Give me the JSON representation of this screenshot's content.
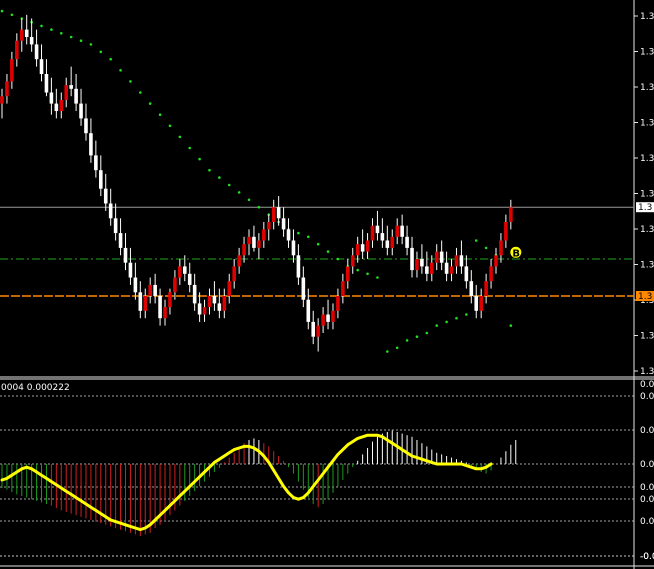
{
  "chart_data": [
    {
      "type": "candlestick",
      "panel": "main",
      "y_tick_labels": [
        "1.3",
        "1.3",
        "1.3",
        "1.3",
        "1.3",
        "1.3",
        "1.3",
        "1.3",
        "1.3",
        "1.3",
        "1.3"
      ],
      "price_marker_label": "1.3",
      "lower_marker_label": "1.3",
      "colors": {
        "background": "#000000",
        "bull": "#e00000",
        "bear": "#ffffff",
        "wick": "#ffffff",
        "sar": "#22dd22",
        "ma_dashed": "#22aa22",
        "hline": "#ff8800",
        "price_line": "#9a9a9a",
        "marker_bg": "#ffff00"
      },
      "ylim": [
        0,
        100
      ],
      "candles": [
        {
          "o": 72,
          "h": 76,
          "l": 68,
          "c": 74
        },
        {
          "o": 74,
          "h": 80,
          "l": 72,
          "c": 78
        },
        {
          "o": 78,
          "h": 86,
          "l": 76,
          "c": 84
        },
        {
          "o": 84,
          "h": 91,
          "l": 82,
          "c": 89
        },
        {
          "o": 89,
          "h": 95,
          "l": 86,
          "c": 92
        },
        {
          "o": 92,
          "h": 96,
          "l": 88,
          "c": 90
        },
        {
          "o": 90,
          "h": 95,
          "l": 86,
          "c": 88
        },
        {
          "o": 88,
          "h": 92,
          "l": 82,
          "c": 84
        },
        {
          "o": 84,
          "h": 88,
          "l": 78,
          "c": 80
        },
        {
          "o": 80,
          "h": 84,
          "l": 74,
          "c": 75
        },
        {
          "o": 75,
          "h": 79,
          "l": 69,
          "c": 72
        },
        {
          "o": 72,
          "h": 76,
          "l": 68,
          "c": 70
        },
        {
          "o": 70,
          "h": 75,
          "l": 68,
          "c": 73
        },
        {
          "o": 73,
          "h": 79,
          "l": 71,
          "c": 77
        },
        {
          "o": 77,
          "h": 82,
          "l": 74,
          "c": 76
        },
        {
          "o": 76,
          "h": 80,
          "l": 70,
          "c": 72
        },
        {
          "o": 72,
          "h": 76,
          "l": 66,
          "c": 68
        },
        {
          "o": 68,
          "h": 72,
          "l": 62,
          "c": 64
        },
        {
          "o": 64,
          "h": 68,
          "l": 56,
          "c": 58
        },
        {
          "o": 58,
          "h": 62,
          "l": 52,
          "c": 54
        },
        {
          "o": 54,
          "h": 58,
          "l": 47,
          "c": 49
        },
        {
          "o": 49,
          "h": 53,
          "l": 43,
          "c": 45
        },
        {
          "o": 45,
          "h": 49,
          "l": 39,
          "c": 41
        },
        {
          "o": 41,
          "h": 45,
          "l": 35,
          "c": 37
        },
        {
          "o": 37,
          "h": 41,
          "l": 31,
          "c": 33
        },
        {
          "o": 33,
          "h": 37,
          "l": 27,
          "c": 29
        },
        {
          "o": 29,
          "h": 33,
          "l": 23,
          "c": 25
        },
        {
          "o": 25,
          "h": 29,
          "l": 19,
          "c": 21
        },
        {
          "o": 21,
          "h": 24,
          "l": 14,
          "c": 16
        },
        {
          "o": 16,
          "h": 22,
          "l": 14,
          "c": 20
        },
        {
          "o": 20,
          "h": 25,
          "l": 18,
          "c": 23
        },
        {
          "o": 23,
          "h": 26,
          "l": 18,
          "c": 20
        },
        {
          "o": 20,
          "h": 22,
          "l": 12,
          "c": 14
        },
        {
          "o": 14,
          "h": 19,
          "l": 12,
          "c": 17
        },
        {
          "o": 17,
          "h": 22,
          "l": 15,
          "c": 21
        },
        {
          "o": 21,
          "h": 27,
          "l": 19,
          "c": 25
        },
        {
          "o": 25,
          "h": 30,
          "l": 23,
          "c": 28
        },
        {
          "o": 28,
          "h": 31,
          "l": 24,
          "c": 26
        },
        {
          "o": 26,
          "h": 29,
          "l": 21,
          "c": 23
        },
        {
          "o": 23,
          "h": 26,
          "l": 16,
          "c": 18
        },
        {
          "o": 18,
          "h": 21,
          "l": 13,
          "c": 15
        },
        {
          "o": 15,
          "h": 19,
          "l": 13,
          "c": 17
        },
        {
          "o": 17,
          "h": 22,
          "l": 15,
          "c": 20
        },
        {
          "o": 20,
          "h": 24,
          "l": 16,
          "c": 18
        },
        {
          "o": 18,
          "h": 22,
          "l": 14,
          "c": 16
        },
        {
          "o": 16,
          "h": 22,
          "l": 14,
          "c": 20
        },
        {
          "o": 20,
          "h": 26,
          "l": 18,
          "c": 24
        },
        {
          "o": 24,
          "h": 30,
          "l": 22,
          "c": 28
        },
        {
          "o": 28,
          "h": 33,
          "l": 26,
          "c": 31
        },
        {
          "o": 31,
          "h": 36,
          "l": 29,
          "c": 34
        },
        {
          "o": 34,
          "h": 38,
          "l": 31,
          "c": 36
        },
        {
          "o": 36,
          "h": 39,
          "l": 32,
          "c": 33
        },
        {
          "o": 33,
          "h": 37,
          "l": 30,
          "c": 35
        },
        {
          "o": 35,
          "h": 40,
          "l": 33,
          "c": 38
        },
        {
          "o": 38,
          "h": 42,
          "l": 35,
          "c": 40
        },
        {
          "o": 40,
          "h": 46,
          "l": 38,
          "c": 44
        },
        {
          "o": 44,
          "h": 47,
          "l": 39,
          "c": 41
        },
        {
          "o": 41,
          "h": 44,
          "l": 36,
          "c": 38
        },
        {
          "o": 38,
          "h": 41,
          "l": 33,
          "c": 35
        },
        {
          "o": 35,
          "h": 38,
          "l": 29,
          "c": 31
        },
        {
          "o": 31,
          "h": 34,
          "l": 23,
          "c": 25
        },
        {
          "o": 25,
          "h": 28,
          "l": 17,
          "c": 19
        },
        {
          "o": 19,
          "h": 22,
          "l": 11,
          "c": 13
        },
        {
          "o": 13,
          "h": 16,
          "l": 7,
          "c": 9
        },
        {
          "o": 9,
          "h": 14,
          "l": 5,
          "c": 12
        },
        {
          "o": 12,
          "h": 17,
          "l": 10,
          "c": 15
        },
        {
          "o": 15,
          "h": 19,
          "l": 11,
          "c": 13
        },
        {
          "o": 13,
          "h": 18,
          "l": 11,
          "c": 16
        },
        {
          "o": 16,
          "h": 22,
          "l": 14,
          "c": 20
        },
        {
          "o": 20,
          "h": 26,
          "l": 18,
          "c": 24
        },
        {
          "o": 24,
          "h": 30,
          "l": 22,
          "c": 28
        },
        {
          "o": 28,
          "h": 33,
          "l": 26,
          "c": 31
        },
        {
          "o": 31,
          "h": 36,
          "l": 29,
          "c": 34
        },
        {
          "o": 34,
          "h": 38,
          "l": 30,
          "c": 32
        },
        {
          "o": 32,
          "h": 37,
          "l": 30,
          "c": 35
        },
        {
          "o": 35,
          "h": 41,
          "l": 33,
          "c": 39
        },
        {
          "o": 39,
          "h": 43,
          "l": 35,
          "c": 37
        },
        {
          "o": 37,
          "h": 41,
          "l": 33,
          "c": 35
        },
        {
          "o": 35,
          "h": 39,
          "l": 31,
          "c": 33
        },
        {
          "o": 33,
          "h": 38,
          "l": 31,
          "c": 36
        },
        {
          "o": 36,
          "h": 41,
          "l": 34,
          "c": 39
        },
        {
          "o": 39,
          "h": 42,
          "l": 34,
          "c": 36
        },
        {
          "o": 36,
          "h": 39,
          "l": 31,
          "c": 33
        },
        {
          "o": 33,
          "h": 36,
          "l": 25,
          "c": 27
        },
        {
          "o": 27,
          "h": 32,
          "l": 25,
          "c": 30
        },
        {
          "o": 30,
          "h": 34,
          "l": 26,
          "c": 28
        },
        {
          "o": 28,
          "h": 32,
          "l": 24,
          "c": 26
        },
        {
          "o": 26,
          "h": 31,
          "l": 24,
          "c": 29
        },
        {
          "o": 29,
          "h": 34,
          "l": 27,
          "c": 32
        },
        {
          "o": 32,
          "h": 35,
          "l": 27,
          "c": 29
        },
        {
          "o": 29,
          "h": 32,
          "l": 24,
          "c": 26
        },
        {
          "o": 26,
          "h": 30,
          "l": 24,
          "c": 28
        },
        {
          "o": 28,
          "h": 33,
          "l": 26,
          "c": 31
        },
        {
          "o": 31,
          "h": 35,
          "l": 26,
          "c": 28
        },
        {
          "o": 28,
          "h": 31,
          "l": 22,
          "c": 24
        },
        {
          "o": 24,
          "h": 27,
          "l": 18,
          "c": 20
        },
        {
          "o": 20,
          "h": 23,
          "l": 14,
          "c": 16
        },
        {
          "o": 16,
          "h": 22,
          "l": 14,
          "c": 20
        },
        {
          "o": 20,
          "h": 26,
          "l": 18,
          "c": 24
        },
        {
          "o": 24,
          "h": 30,
          "l": 22,
          "c": 28
        },
        {
          "o": 28,
          "h": 33,
          "l": 26,
          "c": 31
        },
        {
          "o": 31,
          "h": 37,
          "l": 29,
          "c": 35
        },
        {
          "o": 35,
          "h": 42,
          "l": 33,
          "c": 40
        },
        {
          "o": 40,
          "h": 46,
          "l": 38,
          "c": 44
        }
      ],
      "sar": [
        {
          "i": 0,
          "v": 97
        },
        {
          "i": 2,
          "v": 96
        },
        {
          "i": 4,
          "v": 95
        },
        {
          "i": 6,
          "v": 94
        },
        {
          "i": 8,
          "v": 93
        },
        {
          "i": 10,
          "v": 92
        },
        {
          "i": 12,
          "v": 91
        },
        {
          "i": 14,
          "v": 90
        },
        {
          "i": 16,
          "v": 89
        },
        {
          "i": 18,
          "v": 88
        },
        {
          "i": 20,
          "v": 86
        },
        {
          "i": 22,
          "v": 84
        },
        {
          "i": 24,
          "v": 81
        },
        {
          "i": 26,
          "v": 78
        },
        {
          "i": 28,
          "v": 75
        },
        {
          "i": 30,
          "v": 72
        },
        {
          "i": 32,
          "v": 69
        },
        {
          "i": 34,
          "v": 66
        },
        {
          "i": 36,
          "v": 63
        },
        {
          "i": 38,
          "v": 60
        },
        {
          "i": 40,
          "v": 57
        },
        {
          "i": 42,
          "v": 54
        },
        {
          "i": 44,
          "v": 52
        },
        {
          "i": 46,
          "v": 50
        },
        {
          "i": 48,
          "v": 48
        },
        {
          "i": 50,
          "v": 46
        },
        {
          "i": 52,
          "v": 44
        },
        {
          "i": 54,
          "v": 42
        },
        {
          "i": 56,
          "v": 40
        },
        {
          "i": 58,
          "v": 38
        },
        {
          "i": 60,
          "v": 37
        },
        {
          "i": 62,
          "v": 36
        },
        {
          "i": 64,
          "v": 34
        },
        {
          "i": 66,
          "v": 32
        },
        {
          "i": 68,
          "v": 30
        },
        {
          "i": 70,
          "v": 28
        },
        {
          "i": 72,
          "v": 27
        },
        {
          "i": 74,
          "v": 26
        },
        {
          "i": 76,
          "v": 25
        },
        {
          "i": 78,
          "v": 5
        },
        {
          "i": 80,
          "v": 6
        },
        {
          "i": 82,
          "v": 8
        },
        {
          "i": 84,
          "v": 9
        },
        {
          "i": 86,
          "v": 10
        },
        {
          "i": 88,
          "v": 12
        },
        {
          "i": 90,
          "v": 13
        },
        {
          "i": 92,
          "v": 14
        },
        {
          "i": 94,
          "v": 15
        },
        {
          "i": 96,
          "v": 35
        },
        {
          "i": 98,
          "v": 33
        },
        {
          "i": 100,
          "v": 31
        },
        {
          "i": 103,
          "v": 12
        }
      ],
      "price_line": 44,
      "dashed_level": 30,
      "orange_level": 20,
      "signal": {
        "i": 103,
        "v": 31,
        "label": "B"
      }
    },
    {
      "type": "histogram+line",
      "panel": "indicator",
      "label": "0004 0.000222",
      "y_tick_labels": [
        "0.00",
        "0.00",
        "0.00",
        "0.00",
        "0.00",
        "0.00",
        "0.00",
        "-0.0",
        "-0.0"
      ],
      "ylim": [
        -1,
        1
      ],
      "zero": 0,
      "histogram": [
        -0.3,
        -0.32,
        -0.35,
        -0.38,
        -0.4,
        -0.42,
        -0.44,
        -0.46,
        -0.48,
        -0.5,
        -0.52,
        -0.55,
        -0.58,
        -0.6,
        -0.62,
        -0.64,
        -0.66,
        -0.68,
        -0.7,
        -0.72,
        -0.74,
        -0.76,
        -0.78,
        -0.8,
        -0.82,
        -0.84,
        -0.86,
        -0.88,
        -0.9,
        -0.88,
        -0.86,
        -0.8,
        -0.76,
        -0.7,
        -0.64,
        -0.58,
        -0.52,
        -0.46,
        -0.4,
        -0.34,
        -0.28,
        -0.22,
        -0.16,
        -0.1,
        -0.05,
        0.02,
        0.08,
        0.14,
        0.2,
        0.26,
        0.3,
        0.32,
        0.3,
        0.26,
        0.22,
        0.16,
        0.1,
        0.04,
        -0.04,
        -0.12,
        -0.22,
        -0.32,
        -0.42,
        -0.5,
        -0.54,
        -0.5,
        -0.44,
        -0.36,
        -0.28,
        -0.2,
        -0.12,
        -0.04,
        0.04,
        0.12,
        0.2,
        0.28,
        0.34,
        0.38,
        0.4,
        0.42,
        0.4,
        0.38,
        0.36,
        0.34,
        0.3,
        0.26,
        0.22,
        0.18,
        0.14,
        0.12,
        0.1,
        0.08,
        0.06,
        0.04,
        0.02,
        -0.02,
        -0.06,
        -0.1,
        -0.12,
        -0.08,
        0.0,
        0.08,
        0.16,
        0.24,
        0.3
      ],
      "signal_line": [
        -0.2,
        -0.18,
        -0.14,
        -0.1,
        -0.06,
        -0.04,
        -0.06,
        -0.1,
        -0.14,
        -0.18,
        -0.22,
        -0.26,
        -0.3,
        -0.34,
        -0.38,
        -0.42,
        -0.46,
        -0.5,
        -0.54,
        -0.58,
        -0.62,
        -0.66,
        -0.7,
        -0.72,
        -0.74,
        -0.76,
        -0.78,
        -0.8,
        -0.82,
        -0.8,
        -0.76,
        -0.7,
        -0.64,
        -0.58,
        -0.52,
        -0.46,
        -0.4,
        -0.34,
        -0.28,
        -0.22,
        -0.16,
        -0.1,
        -0.04,
        0.02,
        0.06,
        0.1,
        0.14,
        0.18,
        0.2,
        0.22,
        0.22,
        0.2,
        0.16,
        0.1,
        0.02,
        -0.08,
        -0.18,
        -0.28,
        -0.36,
        -0.42,
        -0.44,
        -0.42,
        -0.36,
        -0.28,
        -0.2,
        -0.12,
        -0.04,
        0.04,
        0.12,
        0.18,
        0.24,
        0.28,
        0.32,
        0.34,
        0.36,
        0.36,
        0.36,
        0.34,
        0.3,
        0.26,
        0.22,
        0.18,
        0.14,
        0.1,
        0.08,
        0.06,
        0.04,
        0.02,
        0.0,
        0.0,
        0.0,
        0.0,
        0.0,
        0.0,
        -0.02,
        -0.04,
        -0.06,
        -0.06,
        -0.04,
        0.0
      ],
      "colors": {
        "hist_neg_low": "#1e9a1e",
        "hist_pos": "#ffffff",
        "hist_red": "#d02020",
        "signal": "#ffff00",
        "grid": "#d8d8d8"
      }
    }
  ]
}
